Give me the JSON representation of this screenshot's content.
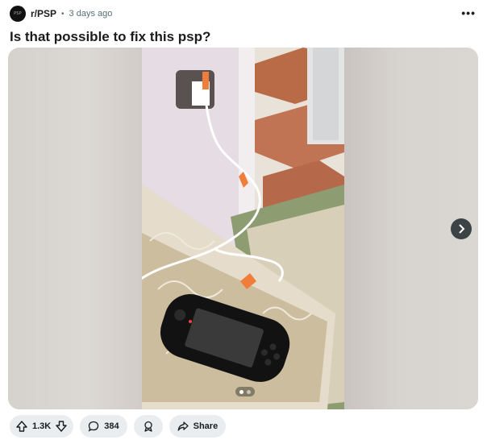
{
  "post": {
    "subreddit": "r/PSP",
    "separator": "•",
    "time": "3 days ago",
    "title": "Is that possible to fix this psp?",
    "avatar_text": "PSP",
    "more_label": "•••"
  },
  "media": {
    "next_icon": "chevron-right-icon",
    "page_count": 2,
    "current_page": 1
  },
  "actions": {
    "upvotes": "1.3K",
    "comments": "384",
    "share": "Share"
  },
  "icons": {
    "upvote": "arrow-up-icon",
    "downvote": "arrow-down-icon",
    "comment": "speech-bubble-icon",
    "award": "award-icon",
    "share": "share-arrow-icon"
  },
  "colors": {
    "pill_bg": "#e9edef",
    "meta_text": "#576f76",
    "next_btn": "#3c4346"
  }
}
